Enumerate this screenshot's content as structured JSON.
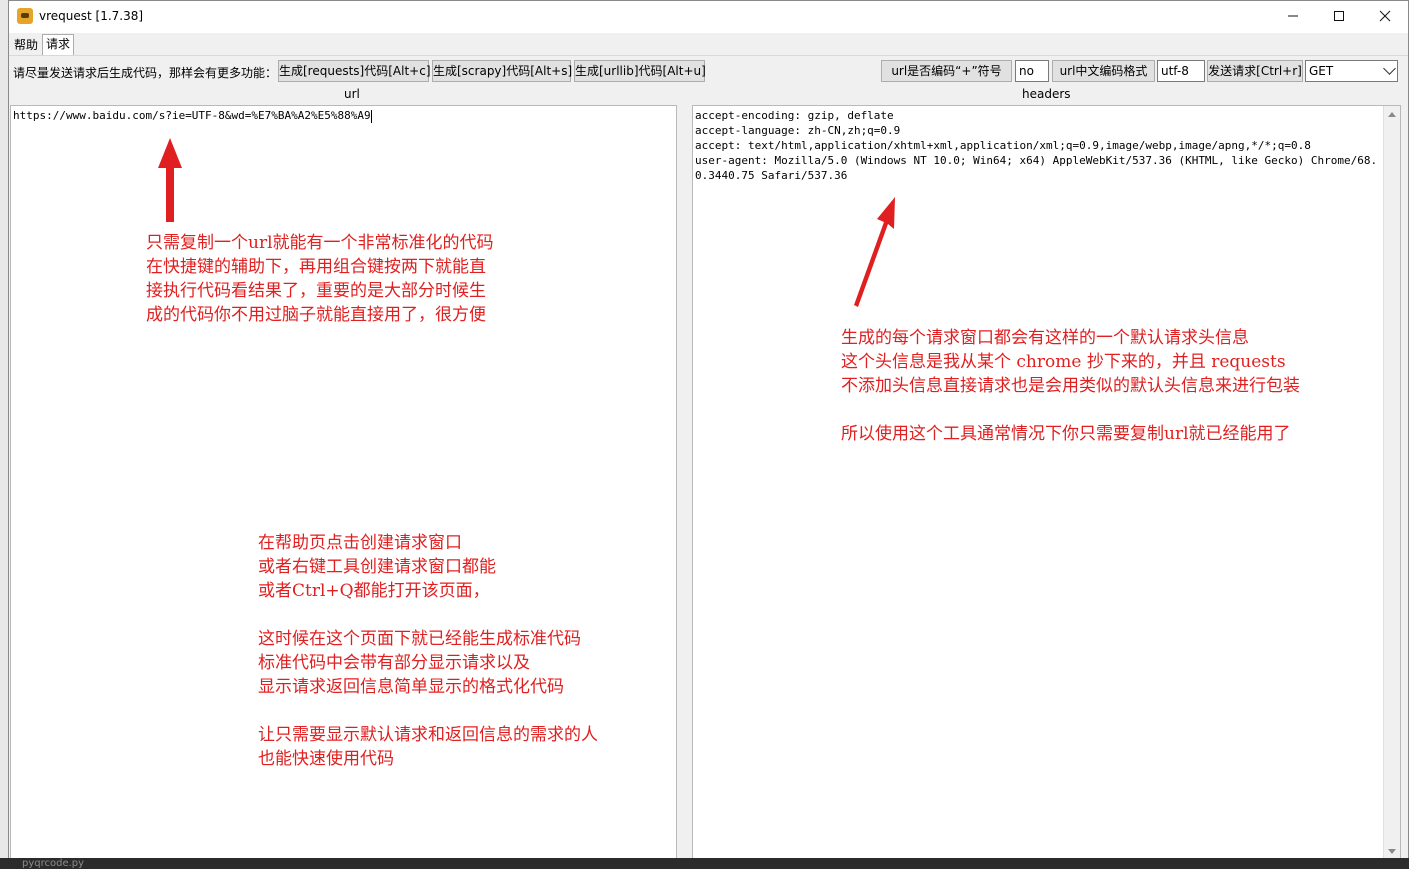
{
  "window": {
    "title": "vrequest [1.7.38]",
    "minimize_icon": "minimize-icon",
    "maximize_icon": "maximize-icon",
    "close_icon": "close-icon"
  },
  "tabs": [
    {
      "label": "帮助"
    },
    {
      "label": "请求"
    }
  ],
  "toolbar": {
    "hint": "请尽量发送请求后生成代码，那样会有更多功能：",
    "gen_requests": "生成[requests]代码[Alt+c]",
    "gen_scrapy": "生成[scrapy]代码[Alt+s]",
    "gen_urllib": "生成[urllib]代码[Alt+u]",
    "url_plus_label": "url是否编码“+”符号",
    "url_plus_value": "no",
    "url_cn_label": "url中文编码格式",
    "url_cn_value": "utf-8",
    "send_label": "发送请求[Ctrl+r]",
    "method_value": "GET"
  },
  "labels": {
    "url": "url",
    "headers": "headers"
  },
  "url_text": "https://www.baidu.com/s?ie=UTF-8&wd=%E7%BA%A2%E5%88%A9",
  "headers_text": "accept-encoding: gzip, deflate\naccept-language: zh-CN,zh;q=0.9\naccept: text/html,application/xhtml+xml,application/xml;q=0.9,image/webp,image/apng,*/*;q=0.8\nuser-agent: Mozilla/5.0 (Windows NT 10.0; Win64; x64) AppleWebKit/537.36 (KHTML, like Gecko) Chrome/68.0.3440.75 Safari/537.36",
  "annotations": {
    "note1": "只需复制一个url就能有一个非常标准化的代码\n在快捷键的辅助下，再用组合键按两下就能直\n接执行代码看结果了，重要的是大部分时候生\n成的代码你不用过脑子就能直接用了，很方便",
    "note2": "生成的每个请求窗口都会有这样的一个默认请求头信息\n这个头信息是我从某个 chrome 抄下来的，并且 requests\n不添加头信息直接请求也是会用类似的默认头信息来进行包装\n\n所以使用这个工具通常情况下你只需要复制url就已经能用了",
    "note3": "在帮助页点击创建请求窗口\n或者右键工具创建请求窗口都能\n或者Ctrl+Q都能打开该页面，\n\n这时候在这个页面下就已经能生成标准代码\n标准代码中会带有部分显示请求以及\n显示请求返回信息简单显示的格式化代码\n\n让只需要显示默认请求和返回信息的需求的人\n也能快速使用代码",
    "color": "#e02020"
  },
  "background": {
    "file_label": "pyqrcode.py"
  }
}
